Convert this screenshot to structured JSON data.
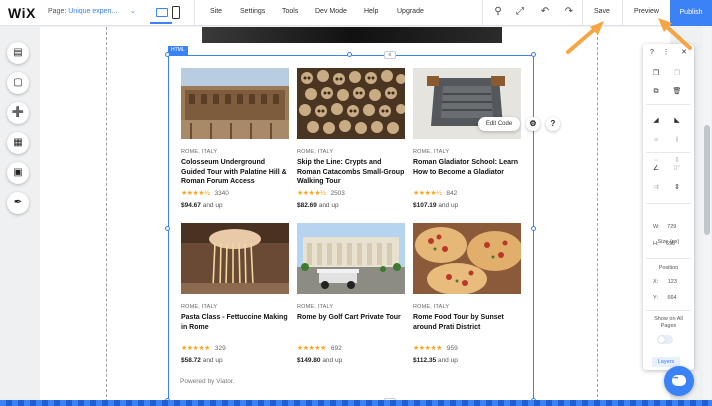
{
  "topbar": {
    "logo": "WiX",
    "page_prefix": "Page:",
    "page_value": "Unique expen...",
    "menu": [
      "Site",
      "Settings",
      "Tools",
      "Dev Mode",
      "Help",
      "Upgrade"
    ],
    "save_label": "Save",
    "preview_label": "Preview",
    "publish_label": "Publish"
  },
  "left_tools": [
    "pages-icon",
    "section-icon",
    "add-icon",
    "app-market-icon",
    "media-icon",
    "pen-icon"
  ],
  "html_element": {
    "tag": "HTML",
    "edit_code_label": "Edit Code",
    "powered_by": "Powered by Viator."
  },
  "tours": [
    {
      "location": "ROME, ITALY",
      "title": "Colosseum Underground Guided Tour with Palatine Hill & Roman Forum Access",
      "stars": "★★★★½",
      "reviews": "3340",
      "price": "$94.67",
      "price_suffix": "and up"
    },
    {
      "location": "ROME, ITALY",
      "title": "Skip the Line: Crypts and Roman Catacombs Small-Group Walking Tour",
      "stars": "★★★★½",
      "reviews": "2503",
      "price": "$82.69",
      "price_suffix": "and up"
    },
    {
      "location": "ROME, ITALY",
      "title": "Roman Gladiator School: Learn How to Become a Gladiator",
      "stars": "★★★★½",
      "reviews": "842",
      "price": "$107.19",
      "price_suffix": "and up"
    },
    {
      "location": "ROME, ITALY",
      "title": "Pasta Class - Fettuccine Making in Rome",
      "stars": "★★★★★",
      "reviews": "329",
      "price": "$58.72",
      "price_suffix": "and up"
    },
    {
      "location": "ROME, ITALY",
      "title": "Rome by Golf Cart Private Tour",
      "stars": "★★★★★",
      "reviews": "692",
      "price": "$149.80",
      "price_suffix": "and up"
    },
    {
      "location": "ROME, ITALY",
      "title": "Rome Food Tour by Sunset around Prati District",
      "stars": "★★★★★",
      "reviews": "959",
      "price": "$112.35",
      "price_suffix": "and up"
    }
  ],
  "panel": {
    "size_label": "Size (px)",
    "w_label": "W:",
    "w_value": "729",
    "h_label": "H:",
    "h_value": "695",
    "position_label": "Position",
    "x_label": "X:",
    "x_value": "123",
    "y_label": "Y:",
    "y_value": "664",
    "show_all_pages": "Show on All Pages",
    "layers_label": "Layers"
  },
  "colors": {
    "accent": "#3b82f6",
    "star": "#f5a623",
    "arrow": "#f5a541"
  }
}
